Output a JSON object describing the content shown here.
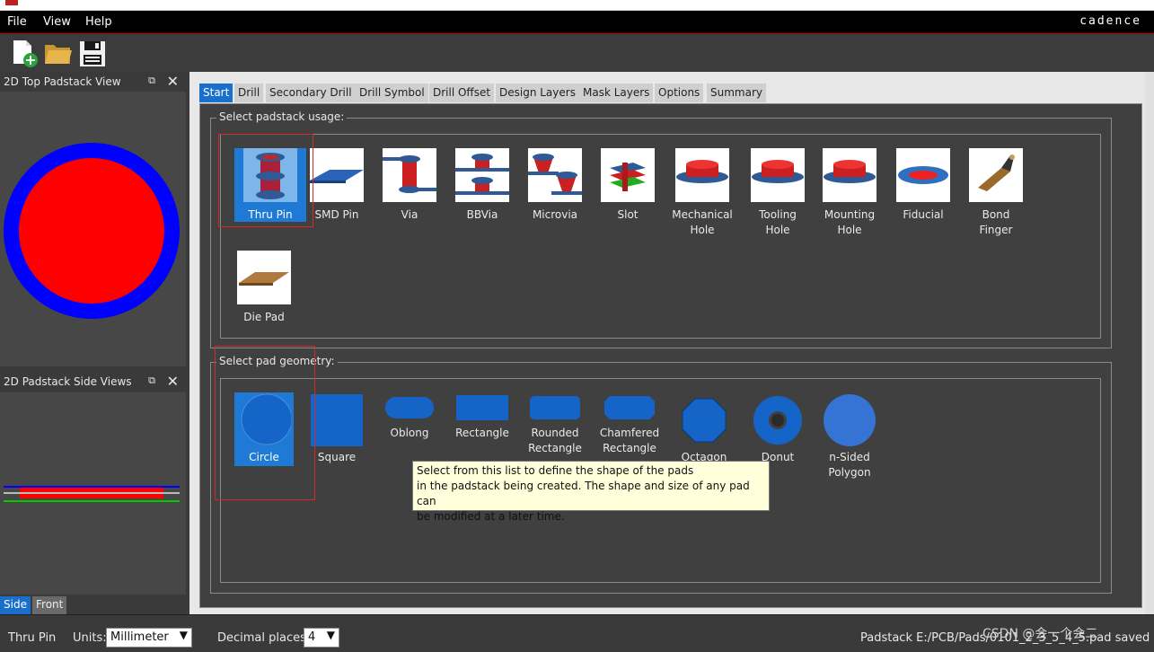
{
  "menu": {
    "file": "File",
    "view": "View",
    "help": "Help",
    "brand": "cadence"
  },
  "toolbar": {
    "new_icon": "new-file-icon",
    "open_icon": "open-folder-icon",
    "save_icon": "save-disk-icon"
  },
  "left_panels": {
    "top_view_title": "2D Top Padstack View",
    "side_view_title": "2D Padstack Side Views",
    "float_glyph": "⧉",
    "close_glyph": "✕",
    "side_tabs": [
      "Side",
      "Front"
    ]
  },
  "tabs": [
    "Start",
    "Drill",
    "Secondary Drill",
    "Drill Symbol",
    "Drill Offset",
    "Design Layers",
    "Mask Layers",
    "Options",
    "Summary"
  ],
  "usage": {
    "title": "Select padstack usage:",
    "items": [
      {
        "label": "Thru Pin"
      },
      {
        "label": "SMD Pin"
      },
      {
        "label": "Via"
      },
      {
        "label": "BBVia"
      },
      {
        "label": "Microvia"
      },
      {
        "label": "Slot"
      },
      {
        "label": "Mechanical\nHole"
      },
      {
        "label": "Tooling\nHole"
      },
      {
        "label": "Mounting\nHole"
      },
      {
        "label": "Fiducial"
      },
      {
        "label": "Bond\nFinger"
      },
      {
        "label": "Die Pad"
      }
    ]
  },
  "geometry": {
    "title": "Select pad geometry:",
    "items": [
      {
        "label": "Circle"
      },
      {
        "label": "Square"
      },
      {
        "label": "Oblong"
      },
      {
        "label": "Rectangle"
      },
      {
        "label": "Rounded\nRectangle"
      },
      {
        "label": "Chamfered\nRectangle"
      },
      {
        "label": "Octagon"
      },
      {
        "label": "Donut"
      },
      {
        "label": "n-Sided\nPolygon"
      }
    ]
  },
  "tooltip": {
    "line1": "Select from this list to define the shape of the pads",
    "line2": "in the padstack being created. The shape and size of any pad can",
    "line3": "be modified at a later time."
  },
  "status": {
    "mode": "Thru Pin",
    "units_label": "Units:",
    "units_value": "Millimeter",
    "decimal_label": "Decimal places:",
    "decimal_value": "4",
    "message": "Padstack E:/PCB/Pads/0101_2_3_5_4_5.pad saved",
    "watermark": "CSDN @会一个会二"
  },
  "colors": {
    "accent": "#1f7ad6",
    "pad_red": "#ff0000",
    "pad_blue": "#0000ff"
  }
}
